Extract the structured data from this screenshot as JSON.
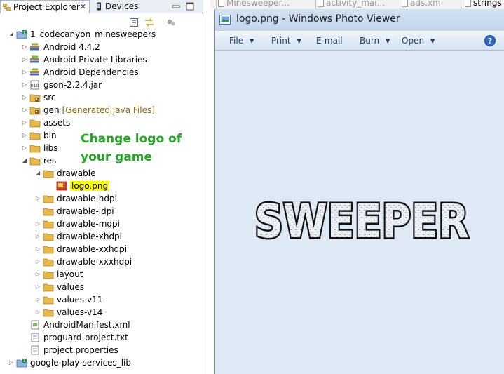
{
  "explorer": {
    "tabs": [
      {
        "label": "Project Explorer",
        "active": true
      },
      {
        "label": "Devices",
        "active": false
      }
    ],
    "close_glyph": "✕",
    "tree": [
      {
        "label": "1_codecanyon_minesweepers",
        "depth": 0,
        "twisty": "open",
        "icon": "android-project-icon"
      },
      {
        "label": "Android 4.4.2",
        "depth": 1,
        "twisty": "closed",
        "icon": "library-icon"
      },
      {
        "label": "Android Private Libraries",
        "depth": 1,
        "twisty": "closed",
        "icon": "library-icon"
      },
      {
        "label": "Android Dependencies",
        "depth": 1,
        "twisty": "closed",
        "icon": "library-icon"
      },
      {
        "label": "gson-2.2.4.jar",
        "depth": 1,
        "twisty": "closed",
        "icon": "jar-icon"
      },
      {
        "label": "src",
        "depth": 1,
        "twisty": "closed",
        "icon": "source-folder-icon"
      },
      {
        "label": "gen",
        "decor": "[Generated Java Files]",
        "depth": 1,
        "twisty": "closed",
        "icon": "source-folder-icon"
      },
      {
        "label": "assets",
        "depth": 1,
        "twisty": "closed",
        "icon": "folder-icon"
      },
      {
        "label": "bin",
        "depth": 1,
        "twisty": "closed",
        "icon": "folder-icon"
      },
      {
        "label": "libs",
        "depth": 1,
        "twisty": "closed",
        "icon": "folder-icon"
      },
      {
        "label": "res",
        "depth": 1,
        "twisty": "open",
        "icon": "folder-icon"
      },
      {
        "label": "drawable",
        "depth": 2,
        "twisty": "open",
        "icon": "folder-icon"
      },
      {
        "label": "logo.png",
        "depth": 3,
        "twisty": "none",
        "icon": "image-file-icon",
        "highlighted": true
      },
      {
        "label": "drawable-hdpi",
        "depth": 2,
        "twisty": "closed",
        "icon": "folder-icon"
      },
      {
        "label": "drawable-ldpi",
        "depth": 2,
        "twisty": "none",
        "icon": "folder-icon"
      },
      {
        "label": "drawable-mdpi",
        "depth": 2,
        "twisty": "closed",
        "icon": "folder-icon"
      },
      {
        "label": "drawable-xhdpi",
        "depth": 2,
        "twisty": "closed",
        "icon": "folder-icon"
      },
      {
        "label": "drawable-xxhdpi",
        "depth": 2,
        "twisty": "closed",
        "icon": "folder-icon"
      },
      {
        "label": "drawable-xxxhdpi",
        "depth": 2,
        "twisty": "closed",
        "icon": "folder-icon"
      },
      {
        "label": "layout",
        "depth": 2,
        "twisty": "closed",
        "icon": "folder-icon"
      },
      {
        "label": "values",
        "depth": 2,
        "twisty": "closed",
        "icon": "folder-icon"
      },
      {
        "label": "values-v11",
        "depth": 2,
        "twisty": "closed",
        "icon": "folder-icon"
      },
      {
        "label": "values-v14",
        "depth": 2,
        "twisty": "closed",
        "icon": "folder-icon"
      },
      {
        "label": "AndroidManifest.xml",
        "depth": 1,
        "twisty": "none",
        "icon": "xml-file-icon"
      },
      {
        "label": "proguard-project.txt",
        "depth": 1,
        "twisty": "none",
        "icon": "text-file-icon"
      },
      {
        "label": "project.properties",
        "depth": 1,
        "twisty": "none",
        "icon": "text-file-icon"
      },
      {
        "label": "google-play-services_lib",
        "depth": 0,
        "twisty": "closed",
        "icon": "android-project-icon"
      }
    ]
  },
  "annotation": {
    "line1": "Change logo of",
    "line2": "your game",
    "color": "#26a826"
  },
  "editor_tabs": [
    {
      "label": "Minesweeper..."
    },
    {
      "label": "activity_mai..."
    },
    {
      "label": "ads.xml"
    },
    {
      "label": "strings"
    }
  ],
  "viewer": {
    "title": "logo.png - Windows Photo Viewer",
    "menus": [
      {
        "label": "File",
        "has_arrow": true
      },
      {
        "label": "Print",
        "has_arrow": true
      },
      {
        "label": "E-mail",
        "has_arrow": false
      },
      {
        "label": "Burn",
        "has_arrow": true
      },
      {
        "label": "Open",
        "has_arrow": true
      }
    ],
    "image_text": "SWEEPER",
    "arrow_glyph": "▼",
    "help_glyph": "?"
  },
  "colors": {
    "highlight": "#ffff00",
    "viewer_background": "#dfe9f5",
    "folder": "#e8b84a",
    "menu_text": "#1e395b"
  }
}
